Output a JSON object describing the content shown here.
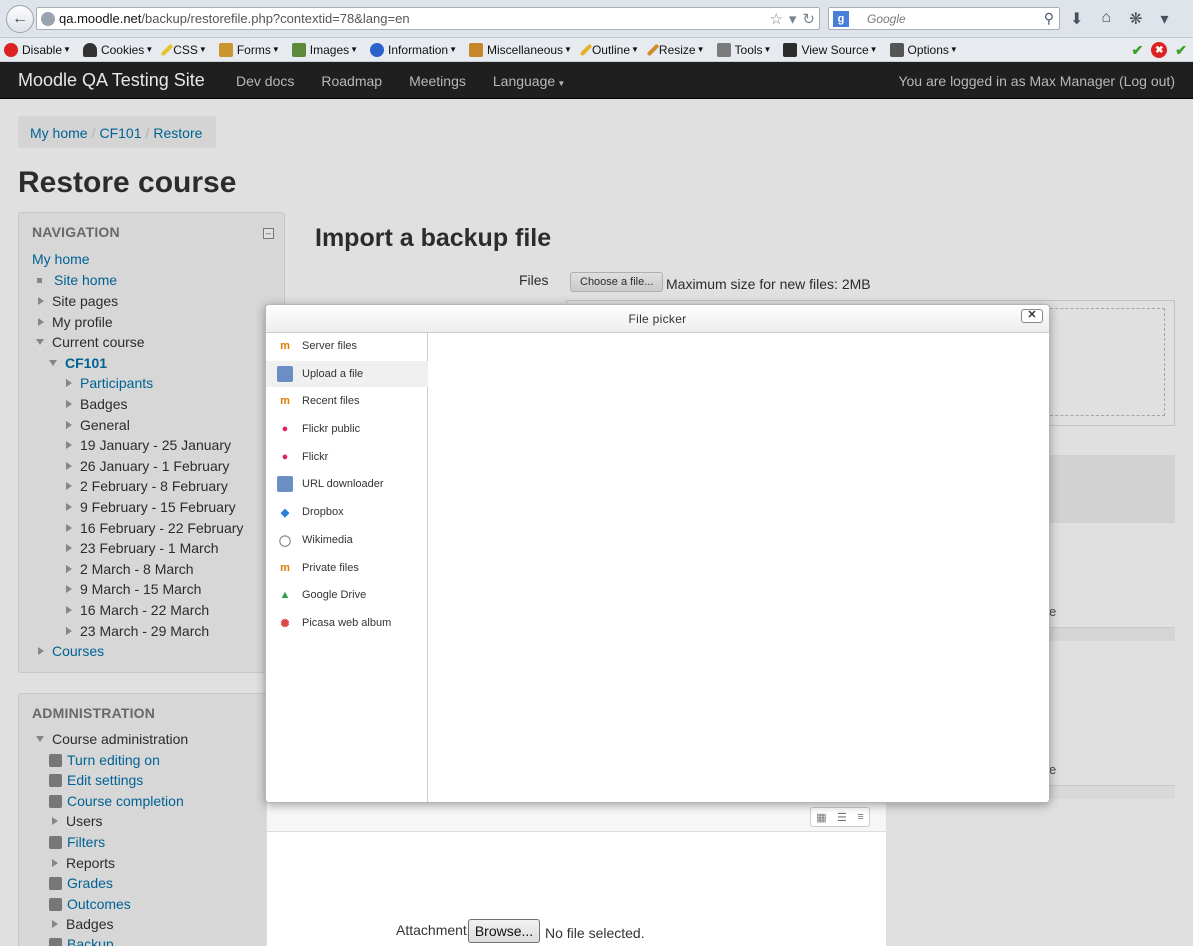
{
  "browser": {
    "url_host": "qa.moodle.net",
    "url_path": "/backup/restorefile.php?contextid=78&lang=en",
    "search_placeholder": "Google",
    "toolbar": [
      "Disable",
      "Cookies",
      "CSS",
      "Forms",
      "Images",
      "Information",
      "Miscellaneous",
      "Outline",
      "Resize",
      "Tools",
      "View Source",
      "Options"
    ]
  },
  "navbar": {
    "brand": "Moodle QA Testing Site",
    "links": [
      "Dev docs",
      "Roadmap",
      "Meetings",
      "Language"
    ],
    "logged_in": "You are logged in as Max Manager (Log out)"
  },
  "breadcrumb": [
    "My home",
    "CF101",
    "Restore"
  ],
  "page_title": "Restore course",
  "navigation": {
    "title": "NAVIGATION",
    "items": [
      "My home",
      "Site home",
      "Site pages",
      "My profile",
      "Current course",
      "CF101",
      "Participants",
      "Badges",
      "General",
      "19 January - 25 January",
      "26 January - 1 February",
      "2 February - 8 February",
      "9 February - 15 February",
      "16 February - 22 February",
      "23 February - 1 March",
      "2 March - 8 March",
      "9 March - 15 March",
      "16 March - 22 March",
      "23 March - 29 March",
      "Courses"
    ]
  },
  "administration": {
    "title": "ADMINISTRATION",
    "items": [
      "Course administration",
      "Turn editing on",
      "Edit settings",
      "Course completion",
      "Users",
      "Filters",
      "Reports",
      "Grades",
      "Outcomes",
      "Badges",
      "Backup"
    ]
  },
  "main": {
    "section_title": "Import a backup file",
    "files_label": "Files",
    "choose_button": "Choose a file...",
    "max_size": "Maximum size for new files: 2MB"
  },
  "file_picker": {
    "title": "File picker",
    "close": "✕",
    "repositories": [
      "Server files",
      "Upload a file",
      "Recent files",
      "Flickr public",
      "Flickr",
      "URL downloader",
      "Dropbox",
      "Wikimedia",
      "Private files",
      "Google Drive",
      "Picasa web album"
    ],
    "active_repository": "Upload a file"
  },
  "upload": {
    "attachment_label": "Attachment:",
    "browse_button": "Browse...",
    "no_file": "No file selected."
  },
  "background_fragments": [
    "e",
    "e"
  ]
}
